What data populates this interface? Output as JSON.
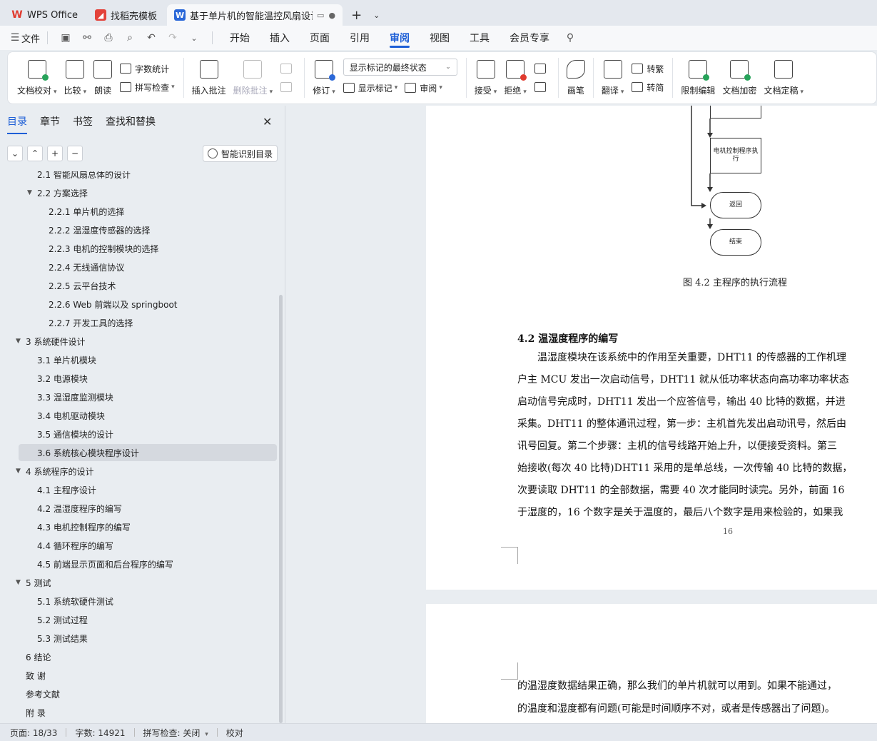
{
  "tabs": [
    {
      "label": "WPS Office"
    },
    {
      "label": "找稻壳模板"
    },
    {
      "label": "基于单片机的智能温控风扇设计"
    }
  ],
  "menu": {
    "file": "文件",
    "tabs": [
      "开始",
      "插入",
      "页面",
      "引用",
      "审阅",
      "视图",
      "工具",
      "会员专享"
    ],
    "active_tab": "审阅"
  },
  "ribbon": {
    "doc_check": "文档校对",
    "compare": "比较",
    "read_aloud": "朗读",
    "word_count": "字数统计",
    "spell_check": "拼写检查",
    "insert_comment": "插入批注",
    "delete_comment": "删除批注",
    "revise": "修订",
    "display_state": "显示标记的最终状态",
    "show_markup": "显示标记",
    "review": "审阅",
    "accept": "接受",
    "reject": "拒绝",
    "pen": "画笔",
    "translate": "翻译",
    "to_traditional": "转繁",
    "to_simplified": "转简",
    "restrict_edit": "限制编辑",
    "encrypt": "文档加密",
    "finalize": "文档定稿"
  },
  "sidebar": {
    "tabs": [
      "目录",
      "章节",
      "书签",
      "查找和替换"
    ],
    "smart_toc": "智能识别目录",
    "toc": [
      {
        "label": "2.1  智能风扇总体的设计"
      },
      {
        "label": "2.2  方案选择"
      },
      {
        "label": "2.2.1  单片机的选择"
      },
      {
        "label": "2.2.2  温湿度传感器的选择"
      },
      {
        "label": "2.2.3  电机的控制模块的选择"
      },
      {
        "label": "2.2.4  无线通信协议"
      },
      {
        "label": "2.2.5  云平台技术"
      },
      {
        "label": "2.2.6  Web 前端以及 springboot"
      },
      {
        "label": "2.2.7  开发工具的选择"
      },
      {
        "label": "3  系统硬件设计"
      },
      {
        "label": "3.1  单片机模块"
      },
      {
        "label": "3.2  电源模块"
      },
      {
        "label": "3.3  温湿度监测模块"
      },
      {
        "label": "3.4  电机驱动模块"
      },
      {
        "label": "3.5  通信模块的设计"
      },
      {
        "label": "3.6  系统核心模块程序设计"
      },
      {
        "label": "4  系统程序的设计"
      },
      {
        "label": "4.1  主程序设计"
      },
      {
        "label": "4.2  温湿度程序的编写"
      },
      {
        "label": "4.3  电机控制程序的编写"
      },
      {
        "label": "4.4  循环程序的编写"
      },
      {
        "label": "4.5  前端显示页面和后台程序的编写"
      },
      {
        "label": "5  测试"
      },
      {
        "label": "5.1  系统软硬件测试"
      },
      {
        "label": "5.2  测试过程"
      },
      {
        "label": "5.3  测试结果"
      },
      {
        "label": "6  结论"
      },
      {
        "label": "致  谢"
      },
      {
        "label": "参考文献"
      },
      {
        "label": "附  录"
      }
    ]
  },
  "document": {
    "flow_motor": "电机控制程序执行",
    "flow_return": "返回",
    "flow_end": "结束",
    "figure_caption": "图 4.2 主程序的执行流程",
    "section_heading": "4.2  温湿度程序的编写",
    "paragraph_lines": [
      "温湿度模块在该系统中的作用至关重要，DHT11 的传感器的工作机理",
      "户主  MCU 发出一次启动信号，DHT11 就从低功率状态向高功率功率状态",
      "启动信号完成时，DHT11 发出一个应答信号，输出 40 比特的数据，并进",
      "采集。DHT11 的整体通讯过程，第一步：主机首先发出启动讯号，然后由",
      "讯号回复。第二个步骤：主机的信号线路开始上升，以便接受资料。第三",
      "始接收(每次 40 比特)DHT11 采用的是单总线，一次传输 40 比特的数据，",
      "次要读取 DHT11 的全部数据，需要 40 次才能同时读完。另外，前面 16",
      "于湿度的，16 个数字是关于温度的，最后八个数字是用来检验的，如果我"
    ],
    "page_number": "16",
    "page2_lines": [
      "的温湿度数据结果正确，那么我们的单片机就可以用到。如果不能通过，",
      "的温度和湿度都有问题(可能是时间顺序不对，或者是传感器出了问题)。"
    ]
  },
  "status": {
    "page": "页面: 18/33",
    "words": "字数: 14921",
    "spell": "拼写检查: 关闭",
    "proof": "校对"
  }
}
